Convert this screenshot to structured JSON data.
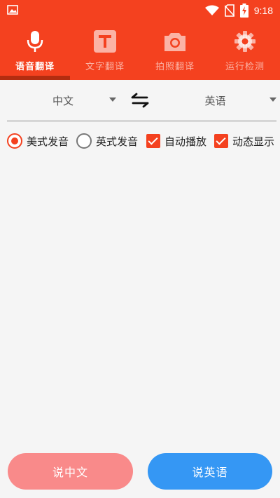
{
  "status_bar": {
    "time": "9:18"
  },
  "tabs": [
    {
      "label": "语音翻译",
      "icon": "microphone-icon",
      "active": true
    },
    {
      "label": "文字翻译",
      "icon": "text-t-icon",
      "active": false
    },
    {
      "label": "拍照翻译",
      "icon": "camera-icon",
      "active": false
    },
    {
      "label": "运行检测",
      "icon": "gear-icon",
      "active": false
    }
  ],
  "languages": {
    "source": "中文",
    "target": "英语"
  },
  "options": {
    "us_pronunciation": {
      "label": "美式发音",
      "selected": true
    },
    "uk_pronunciation": {
      "label": "英式发音",
      "selected": false
    },
    "auto_play": {
      "label": "自动播放",
      "checked": true
    },
    "dynamic_display": {
      "label": "动态显示",
      "checked": true
    }
  },
  "buttons": {
    "speak_chinese": "说中文",
    "speak_english": "说英语"
  },
  "colors": {
    "primary": "#f4411f",
    "tab_indicator": "#b32d10",
    "chinese_button": "#f98a8a",
    "english_button": "#3597f4"
  }
}
